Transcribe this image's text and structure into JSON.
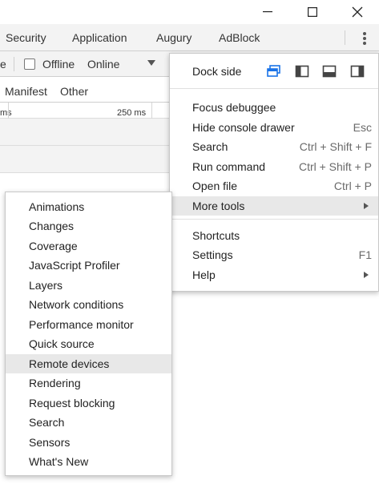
{
  "window_controls": {
    "minimize": "minimize",
    "maximize": "maximize",
    "close": "close"
  },
  "tabs": [
    "Security",
    "Application",
    "Augury",
    "AdBlock"
  ],
  "toolbar": {
    "partial_label": "e",
    "offline_label": "Offline",
    "throttle_value": "Online"
  },
  "filters": {
    "items": [
      "Manifest",
      "Other"
    ]
  },
  "timeline": {
    "partial_label": "ms",
    "tick_label": "250 ms"
  },
  "main_menu": {
    "dock_side_label": "Dock side",
    "dock_icons": [
      "undock-icon",
      "dock-left-icon",
      "dock-bottom-icon",
      "dock-right-icon"
    ],
    "items": [
      {
        "label": "Focus debuggee",
        "shortcut": ""
      },
      {
        "label": "Hide console drawer",
        "shortcut": "Esc"
      },
      {
        "label": "Search",
        "shortcut": "Ctrl + Shift + F"
      },
      {
        "label": "Run command",
        "shortcut": "Ctrl + Shift + P"
      },
      {
        "label": "Open file",
        "shortcut": "Ctrl + P"
      },
      {
        "label": "More tools",
        "shortcut": ""
      }
    ],
    "items2": [
      {
        "label": "Shortcuts",
        "shortcut": ""
      },
      {
        "label": "Settings",
        "shortcut": "F1"
      },
      {
        "label": "Help",
        "shortcut": ""
      }
    ]
  },
  "more_tools_submenu": {
    "items": [
      "Animations",
      "Changes",
      "Coverage",
      "JavaScript Profiler",
      "Layers",
      "Network conditions",
      "Performance monitor",
      "Quick source",
      "Remote devices",
      "Rendering",
      "Request blocking",
      "Search",
      "Sensors",
      "What's New"
    ],
    "highlighted": "Remote devices"
  },
  "colors": {
    "accent": "#1a73e8",
    "highlight": "#e8e8e8",
    "toolbar_bg": "#f3f3f3"
  }
}
